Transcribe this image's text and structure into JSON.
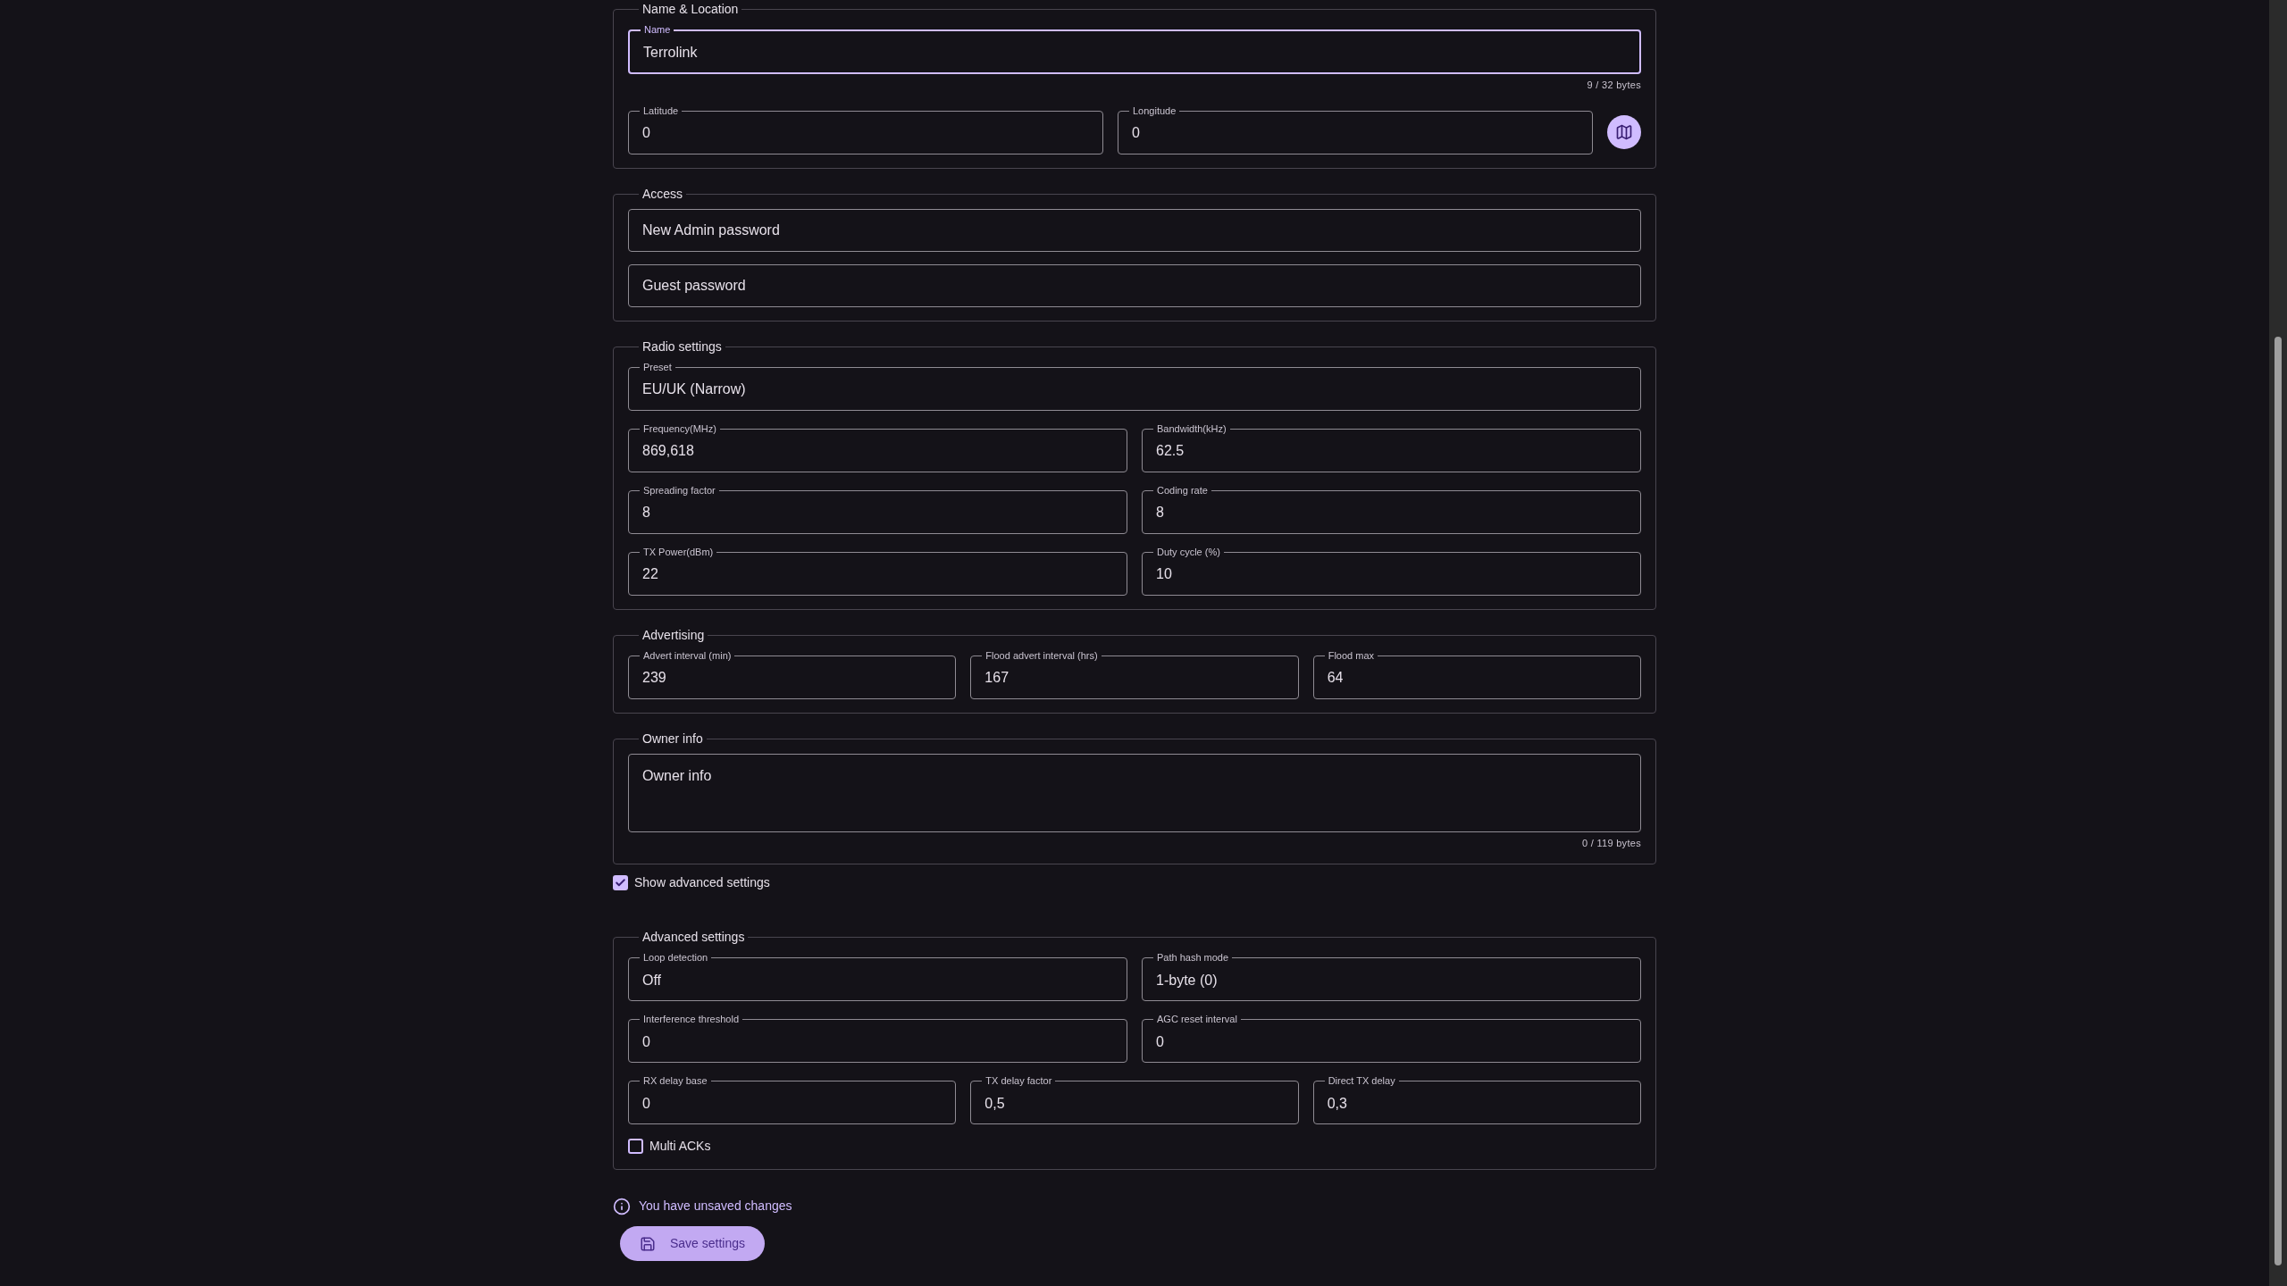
{
  "items": [
    {
      "kind": "section",
      "title": "Name & Location",
      "rows": [
        {
          "fields": [
            {
              "kind": "text",
              "label": "Name",
              "value": "Terrolink",
              "focused": true
            }
          ],
          "counter": "9 / 32 bytes"
        },
        {
          "fields": [
            {
              "kind": "text",
              "label": "Latitude",
              "value": "0",
              "focused": false
            },
            {
              "kind": "text",
              "label": "Longitude",
              "value": "0",
              "focused": false
            }
          ],
          "map_button": true
        }
      ]
    },
    {
      "kind": "section",
      "title": "Access",
      "rows": [
        {
          "fields": [
            {
              "kind": "text",
              "placeholder": "New Admin password",
              "focused": false
            }
          ]
        },
        {
          "fields": [
            {
              "kind": "text",
              "placeholder": "Guest password",
              "focused": false
            }
          ]
        }
      ]
    },
    {
      "kind": "section",
      "title": "Radio settings",
      "rows": [
        {
          "fields": [
            {
              "kind": "text",
              "label": "Preset",
              "value": "EU/UK (Narrow)",
              "focused": false
            }
          ]
        },
        {
          "fields": [
            {
              "kind": "text",
              "label": "Frequency(MHz)",
              "value": "869,618",
              "focused": false
            },
            {
              "kind": "text",
              "label": "Bandwidth(kHz)",
              "value": "62.5",
              "focused": false
            }
          ]
        },
        {
          "fields": [
            {
              "kind": "text",
              "label": "Spreading factor",
              "value": "8",
              "focused": false
            },
            {
              "kind": "text",
              "label": "Coding rate",
              "value": "8",
              "focused": false
            }
          ]
        },
        {
          "fields": [
            {
              "kind": "text",
              "label": "TX Power(dBm)",
              "value": "22",
              "focused": false
            },
            {
              "kind": "text",
              "label": "Duty cycle (%)",
              "value": "10",
              "focused": false
            }
          ]
        }
      ]
    },
    {
      "kind": "section",
      "title": "Advertising",
      "rows": [
        {
          "fields": [
            {
              "kind": "text",
              "label": "Advert interval (min)",
              "value": "239",
              "focused": false
            },
            {
              "kind": "text",
              "label": "Flood advert interval (hrs)",
              "value": "167",
              "focused": false
            },
            {
              "kind": "text",
              "label": "Flood max",
              "value": "64",
              "focused": false
            }
          ]
        }
      ]
    },
    {
      "kind": "section",
      "title": "Owner info",
      "rows": [
        {
          "fields": [
            {
              "kind": "textarea",
              "placeholder": "Owner info",
              "focused": false
            }
          ],
          "counter": "0 / 119 bytes"
        }
      ]
    },
    {
      "kind": "checkbox",
      "label": "Show advanced settings",
      "checked": true
    },
    {
      "kind": "section",
      "title": "Advanced settings",
      "rows": [
        {
          "fields": [
            {
              "kind": "text",
              "label": "Loop detection",
              "value": "Off",
              "focused": false
            },
            {
              "kind": "text",
              "label": "Path hash mode",
              "value": "1-byte (0)",
              "focused": false
            }
          ]
        },
        {
          "fields": [
            {
              "kind": "text",
              "label": "Interference threshold",
              "value": "0",
              "focused": false
            },
            {
              "kind": "text",
              "label": "AGC reset interval",
              "value": "0",
              "focused": false
            }
          ]
        },
        {
          "fields": [
            {
              "kind": "text",
              "label": "RX delay base",
              "value": "0",
              "focused": false
            },
            {
              "kind": "text",
              "label": "TX delay factor",
              "value": "0,5",
              "focused": false
            },
            {
              "kind": "text",
              "label": "Direct TX delay",
              "value": "0,3",
              "focused": false
            }
          ]
        }
      ],
      "checkbox": {
        "label": "Multi ACKs",
        "checked": false
      }
    }
  ],
  "status": "You have unsaved changes",
  "save_button": "Save settings"
}
